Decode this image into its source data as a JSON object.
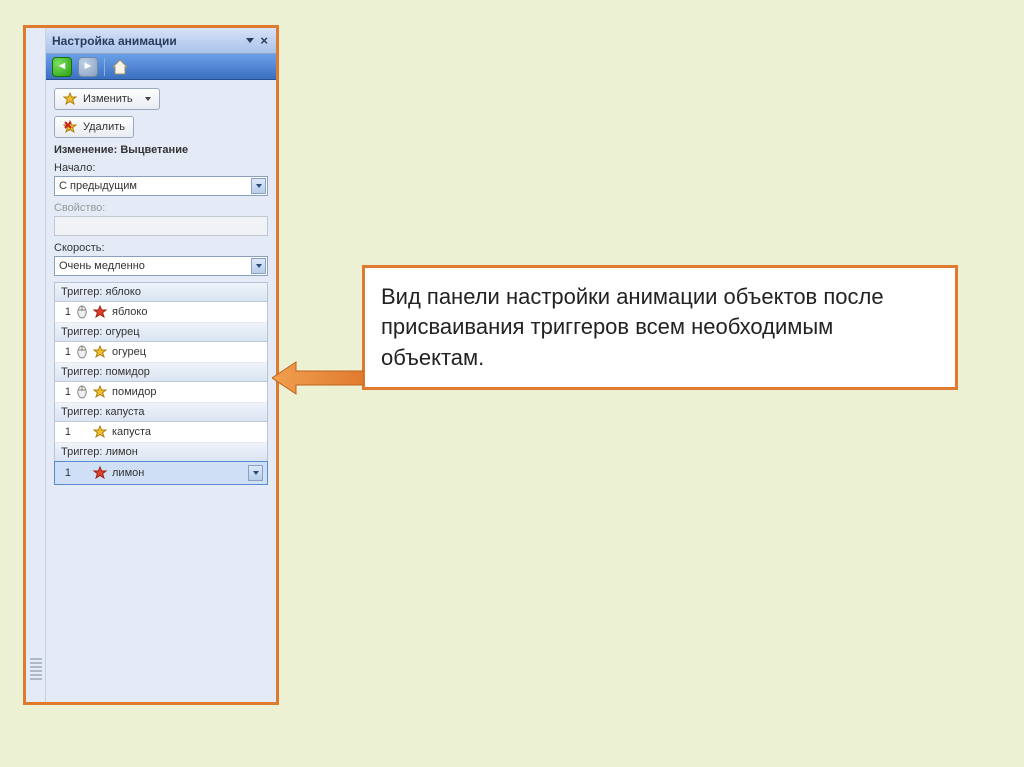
{
  "panel": {
    "title": "Настройка анимации",
    "change_label": "Изменить",
    "delete_label": "Удалить",
    "section": "Изменение: Выцветание",
    "start_label": "Начало:",
    "start_value": "С предыдущим",
    "property_label": "Свойство:",
    "speed_label": "Скорость:",
    "speed_value": "Очень медленно",
    "triggers": [
      {
        "header": "Триггер: яблоко",
        "num": "1",
        "label": "яблоко",
        "mouse": true,
        "color": "red"
      },
      {
        "header": "Триггер: огурец",
        "num": "1",
        "label": "огурец",
        "mouse": true,
        "color": "gold"
      },
      {
        "header": "Триггер: помидор",
        "num": "1",
        "label": "помидор",
        "mouse": true,
        "color": "gold"
      },
      {
        "header": "Триггер: капуста",
        "num": "1",
        "label": "капуста",
        "mouse": false,
        "color": "gold"
      },
      {
        "header": "Триггер: лимон",
        "num": "1",
        "label": "лимон",
        "mouse": false,
        "color": "red",
        "selected": true
      }
    ]
  },
  "callout": "Вид панели настройки анимации объектов после присваивания триггеров всем необходимым объектам."
}
